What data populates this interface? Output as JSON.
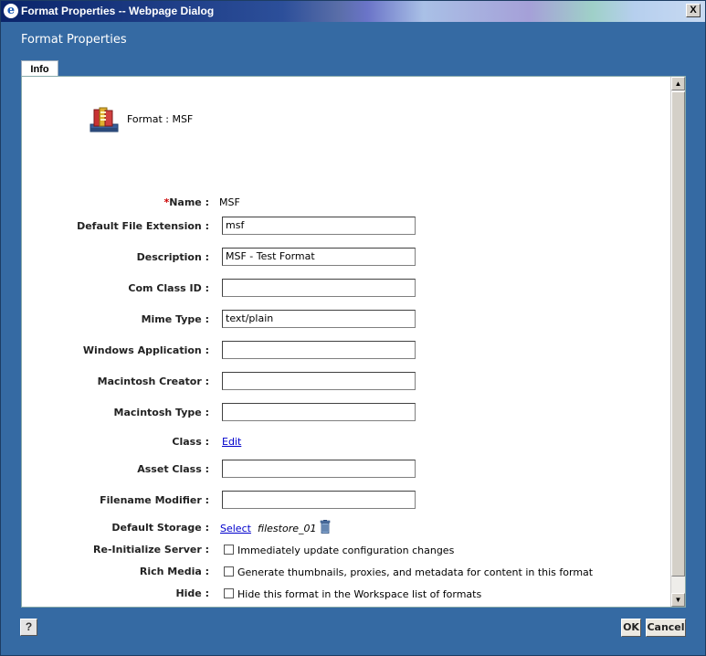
{
  "window": {
    "title": "Format Properties -- Webpage Dialog",
    "close_glyph": "X"
  },
  "dialog": {
    "heading": "Format Properties",
    "tab": "Info"
  },
  "format": {
    "title": "Format : MSF",
    "icon": "format-stack-icon"
  },
  "fields": {
    "name": {
      "required_mark": "*",
      "label": "Name :",
      "value": "MSF"
    },
    "extension": {
      "label": "Default File Extension :",
      "value": "msf"
    },
    "description": {
      "label": "Description :",
      "value": "MSF - Test Format"
    },
    "com_class_id": {
      "label": "Com Class ID :",
      "value": ""
    },
    "mime_type": {
      "label": "Mime Type :",
      "value": "text/plain"
    },
    "windows_app": {
      "label": "Windows Application :",
      "value": ""
    },
    "mac_creator": {
      "label": "Macintosh Creator :",
      "value": ""
    },
    "mac_type": {
      "label": "Macintosh Type :",
      "value": ""
    },
    "class": {
      "label": "Class :",
      "link": "Edit"
    },
    "asset_class": {
      "label": "Asset Class :",
      "value": ""
    },
    "filename_modifier": {
      "label": "Filename Modifier :",
      "value": ""
    },
    "default_storage": {
      "label": "Default Storage :",
      "link": "Select",
      "value": "filestore_01"
    },
    "reinit": {
      "label": "Re-Initialize Server :",
      "option": "Immediately update configuration changes",
      "checked": false
    },
    "rich_media": {
      "label": "Rich Media :",
      "option": "Generate thumbnails, proxies, and metadata for content in this format",
      "checked": false
    },
    "hide": {
      "label": "Hide :",
      "option": "Hide this format in the Workspace list of formats",
      "checked": false
    }
  },
  "footer": {
    "help": "?",
    "ok": "OK",
    "cancel": "Cancel"
  }
}
